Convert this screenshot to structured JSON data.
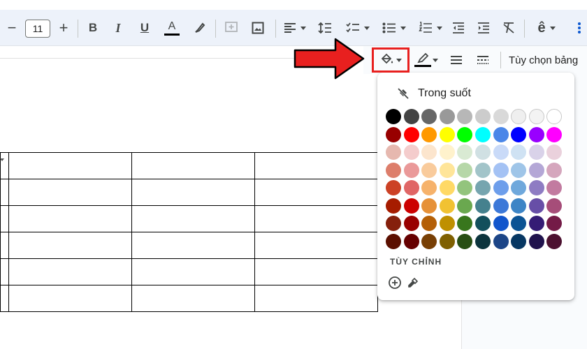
{
  "toolbar": {
    "font_size": "11",
    "minus": "−",
    "plus": "+",
    "bold": "B",
    "italic": "I",
    "underline": "U",
    "font_color_letter": "A"
  },
  "table_toolbar": {
    "options_label": "Tùy chọn bảng"
  },
  "color_panel": {
    "transparent_label": "Trong suốt",
    "custom_label": "TÙY CHỈNH",
    "rows": [
      [
        "#000000",
        "#434343",
        "#666666",
        "#999999",
        "#b7b7b7",
        "#cccccc",
        "#d9d9d9",
        "#efefef",
        "#f3f3f3",
        "#ffffff"
      ],
      [
        "#980000",
        "#ff0000",
        "#ff9900",
        "#ffff00",
        "#00ff00",
        "#00ffff",
        "#4a86e8",
        "#0000ff",
        "#9900ff",
        "#ff00ff"
      ],
      [
        "#e6b8af",
        "#f4cccc",
        "#fce5cd",
        "#fff2cc",
        "#d9ead3",
        "#d0e0e3",
        "#c9daf8",
        "#cfe2f3",
        "#d9d2e9",
        "#ead1dc"
      ],
      [
        "#dd7e6b",
        "#ea9999",
        "#f9cb9c",
        "#ffe599",
        "#b6d7a8",
        "#a2c4c9",
        "#a4c2f4",
        "#9fc5e8",
        "#b4a7d6",
        "#d5a6bd"
      ],
      [
        "#cc4125",
        "#e06666",
        "#f6b26b",
        "#ffd966",
        "#93c47d",
        "#76a5af",
        "#6d9eeb",
        "#6fa8dc",
        "#8e7cc3",
        "#c27ba0"
      ],
      [
        "#a61c00",
        "#cc0000",
        "#e69138",
        "#f1c232",
        "#6aa84f",
        "#45818e",
        "#3c78d8",
        "#3d85c6",
        "#674ea7",
        "#a64d79"
      ],
      [
        "#85200c",
        "#990000",
        "#b45f06",
        "#bf9000",
        "#38761d",
        "#134f5c",
        "#1155cc",
        "#0b5394",
        "#351c75",
        "#741b47"
      ],
      [
        "#5b0f00",
        "#660000",
        "#783f04",
        "#7f6000",
        "#274e13",
        "#0c343d",
        "#1c4587",
        "#073763",
        "#20124d",
        "#4c1130"
      ]
    ]
  },
  "colors": {
    "toolbar_bg": "#edf2fa",
    "highlight_red": "#e8201f",
    "icon_gray": "#444746"
  }
}
